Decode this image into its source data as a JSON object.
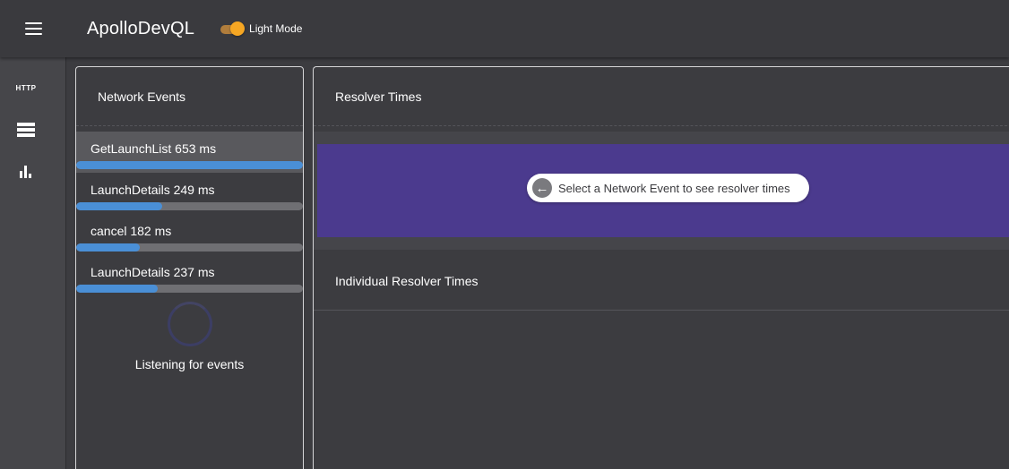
{
  "app": {
    "title": "ApolloDevQL",
    "menu_icon": "menu-icon",
    "theme_toggle": {
      "label": "Light Mode",
      "on": true,
      "color": "#f5a623"
    }
  },
  "rail": {
    "items": [
      {
        "label": "HTTP",
        "icon": "http-text-icon"
      },
      {
        "icon": "server-list-icon"
      },
      {
        "icon": "bar-chart-icon"
      }
    ]
  },
  "events": {
    "title": "Network Events",
    "items": [
      {
        "label": "GetLaunchList 653 ms",
        "progress": 1.0,
        "selected": true
      },
      {
        "label": "LaunchDetails 249 ms",
        "progress": 0.38,
        "selected": false
      },
      {
        "label": "cancel 182 ms",
        "progress": 0.28,
        "selected": false
      },
      {
        "label": "LaunchDetails 237 ms",
        "progress": 0.36,
        "selected": false
      }
    ],
    "listening_text": "Listening for events",
    "bar_color": "#4a8fd6"
  },
  "resolver": {
    "title": "Resolver Times",
    "hint": "Select a Network Event to see resolver times",
    "banner_color": "#4b3a8e",
    "individual_title": "Individual Resolver Times"
  }
}
